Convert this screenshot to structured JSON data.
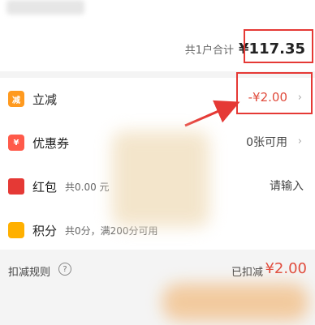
{
  "summary": {
    "total_label": "共1户合计",
    "total_value": "¥117.35"
  },
  "rows": [
    {
      "label": "立减",
      "icon": "减",
      "value": "-¥2.00"
    },
    {
      "label": "优惠券",
      "icon": "¥",
      "value": "0张可用"
    },
    {
      "label": "红包",
      "icon": "",
      "sub": "共0.00 元",
      "value": "请输入"
    },
    {
      "label": "积分",
      "icon": "",
      "sub": "共0分，满200分可用"
    }
  ],
  "footer": {
    "rules_label": "扣减规则",
    "help_icon": "?",
    "deducted_label": "已扣减",
    "deducted_value": "¥2.00"
  },
  "colors": {
    "accent_red": "#e04b3c",
    "orange": "#ff9a1f",
    "coupon_red": "#ff5a4a"
  }
}
